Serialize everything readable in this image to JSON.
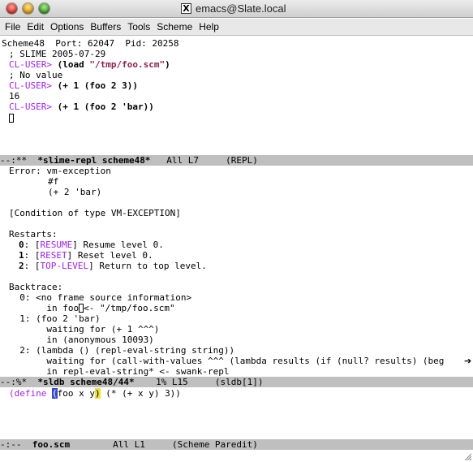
{
  "window": {
    "title": "emacs@Slate.local",
    "x_icon": "X"
  },
  "menu": [
    "File",
    "Edit",
    "Options",
    "Buffers",
    "Tools",
    "Scheme",
    "Help"
  ],
  "header_line": "Scheme48  Port: 62047  Pid: 20258",
  "repl": {
    "banner": "; SLIME 2005-07-29",
    "prompt": "CL-USER>",
    "cmd1_pre": "(load ",
    "cmd1_str": "\"/tmp/foo.scm\"",
    "cmd1_post": ")",
    "result1": "; No value",
    "cmd2": "(+ 1 (foo 2 3))",
    "result2": "16",
    "cmd3": "(+ 1 (foo 2 'bar))"
  },
  "modeline1": {
    "flags": "--:**  ",
    "buffer": "*slime-repl scheme48*",
    "position": "   All L7     ",
    "mode": "(REPL)"
  },
  "sldb": {
    "error_label": "Error: ",
    "error": "vm-exception",
    "error_detail1": "#f",
    "error_detail2": "(+ 2 'bar)",
    "condition": "[Condition of type VM-EXCEPTION]",
    "restarts_header": "Restarts:",
    "restarts": [
      {
        "num": "0",
        "name": "RESUME",
        "desc": " Resume level 0."
      },
      {
        "num": "1",
        "name": "RESET",
        "desc": " Reset level 0."
      },
      {
        "num": "2",
        "name": "TOP-LEVEL",
        "desc": " Return to top level."
      }
    ],
    "backtrace_header": "Backtrace:",
    "frames": [
      {
        "head": "  0: <no frame source information>",
        "lines": [
          "       in foo",
          "<- \"/tmp/foo.scm\""
        ]
      },
      {
        "head": "  1: (foo 2 'bar)",
        "lines": [
          "       waiting for (+ 1 ^^^)",
          "       in (anonymous 10093)"
        ]
      },
      {
        "head": "  2: (lambda () (repl-eval-string string))",
        "lines": [
          "       waiting for (call-with-values ^^^ (lambda results (if (null? results) (beg",
          "       in repl-eval-string* <- swank-repl"
        ]
      }
    ]
  },
  "modeline2": {
    "flags": "--:%*  ",
    "buffer": "*sldb scheme48/44*",
    "position": "    1% L15     ",
    "mode": "(sldb[1])"
  },
  "source": {
    "kw": "(define ",
    "open_paren": "(",
    "sig_rest": "foo x y",
    "close_paren": ")",
    "body": " (* (+ x y) 3))"
  },
  "modeline3": {
    "flags": "-:--  ",
    "buffer": "foo.scm",
    "position": "        All L1     ",
    "mode": "(Scheme Paredit)"
  },
  "colors": {
    "prompt": "#a020f0",
    "string": "#8b2252",
    "modeline_bg": "#bfbfbf",
    "paren_highlight": "#3a49c8",
    "paren_match": "#f0e040"
  }
}
